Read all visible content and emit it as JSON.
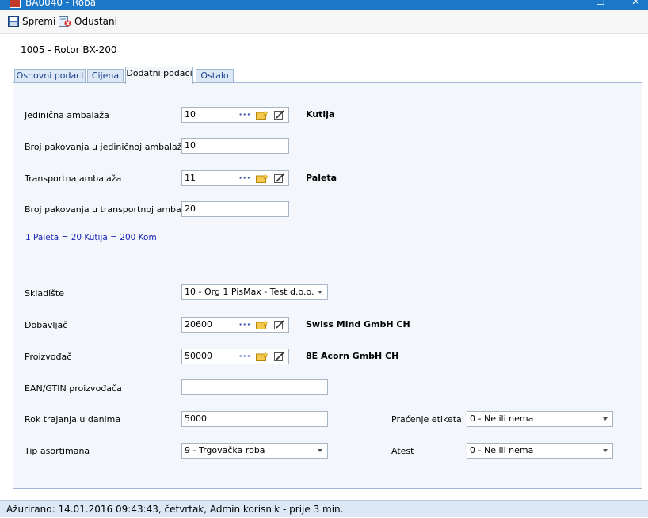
{
  "window": {
    "title": "BA0040 - Roba",
    "minimize": "—",
    "maximize": "☐",
    "close": "✕"
  },
  "toolbar": {
    "save_label": "Spremi",
    "cancel_label": "Odustani"
  },
  "record_title": "1005 - Rotor BX-200",
  "tabs": [
    {
      "label": "Osnovni podaci"
    },
    {
      "label": "Cijena"
    },
    {
      "label": "Dodatni podaci"
    },
    {
      "label": "Ostalo"
    }
  ],
  "form": {
    "unit_pack": {
      "label": "Jedinična ambalaža",
      "value": "10",
      "name": "Kutija"
    },
    "packs_in_unit": {
      "label": "Broj pakovanja u jediničnoj ambalaži",
      "value": "10"
    },
    "transport_pack": {
      "label": "Transportna ambalaža",
      "value": "11",
      "name": "Paleta"
    },
    "packs_in_transport": {
      "label": "Broj pakovanja u transportnoj ambalaži",
      "value": "20"
    },
    "conversion_info": "1 Paleta = 20 Kutija = 200 Kom",
    "warehouse": {
      "label": "Skladište",
      "value": "10 - Org 1 PisMax - Test d.o.o."
    },
    "supplier": {
      "label": "Dobavljač",
      "value": "20600",
      "name": "Swiss Mind GmbH CH"
    },
    "manufacturer": {
      "label": "Proizvođač",
      "value": "50000",
      "name": "8E Acorn GmbH CH"
    },
    "ean": {
      "label": "EAN/GTIN proizvođača",
      "value": ""
    },
    "shelf_life": {
      "label": "Rok trajanja u danima",
      "value": "5000"
    },
    "label_tracking": {
      "label": "Praćenje etiketa",
      "value": "0 - Ne ili nema"
    },
    "assortment_type": {
      "label": "Tip asortimana",
      "value": "9 - Trgovačka roba"
    },
    "certificate": {
      "label": "Atest",
      "value": "0 - Ne ili nema"
    }
  },
  "status_bar": "Ažurirano: 14.01.2016 09:43:43, četvrtak, Admin korisnik -  prije 3 min."
}
